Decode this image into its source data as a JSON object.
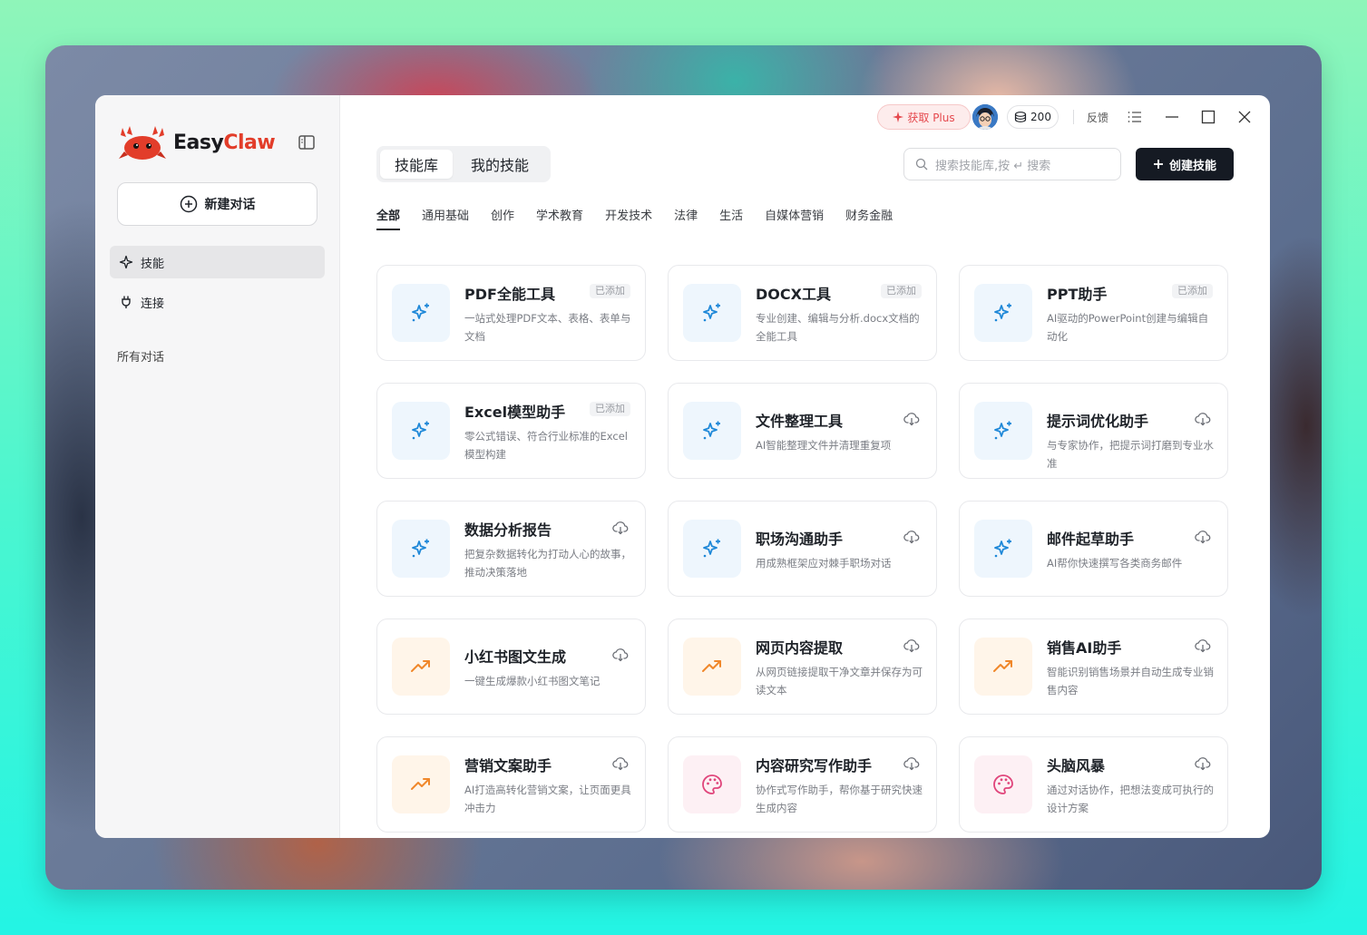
{
  "app": {
    "logo_easy": "Easy",
    "logo_claw": "Claw"
  },
  "sidebar": {
    "new_chat": "新建对话",
    "items": [
      {
        "label": "技能",
        "icon": "sparkle-icon",
        "active": true
      },
      {
        "label": "连接",
        "icon": "plug-icon",
        "active": false
      }
    ],
    "section_label": "所有对话"
  },
  "topbar": {
    "plus_label": "获取 Plus",
    "credits": "200",
    "feedback": "反馈"
  },
  "main": {
    "tabs": [
      {
        "label": "技能库",
        "active": true
      },
      {
        "label": "我的技能",
        "active": false
      }
    ],
    "search_placeholder": "搜索技能库,按 ↵ 搜索",
    "create_label": "创建技能",
    "categories": [
      "全部",
      "通用基础",
      "创作",
      "学术教育",
      "开发技术",
      "法律",
      "生活",
      "自媒体营销",
      "财务金融"
    ],
    "cards": [
      {
        "title": "PDF全能工具",
        "desc": "一站式处理PDF文本、表格、表单与文档",
        "status": "已添加",
        "icon": "sparkles-icon",
        "color": "blue"
      },
      {
        "title": "DOCX工具",
        "desc": "专业创建、编辑与分析.docx文档的全能工具",
        "status": "已添加",
        "icon": "sparkles-icon",
        "color": "blue"
      },
      {
        "title": "PPT助手",
        "desc": "AI驱动的PowerPoint创建与编辑自动化",
        "status": "已添加",
        "icon": "sparkles-icon",
        "color": "blue"
      },
      {
        "title": "Excel模型助手",
        "desc": "零公式错误、符合行业标准的Excel模型构建",
        "status": "已添加",
        "icon": "sparkles-icon",
        "color": "blue"
      },
      {
        "title": "文件整理工具",
        "desc": "AI智能整理文件并清理重复项",
        "status": "download",
        "icon": "sparkles-icon",
        "color": "blue"
      },
      {
        "title": "提示词优化助手",
        "desc": "与专家协作，把提示词打磨到专业水准",
        "status": "download",
        "icon": "sparkles-icon",
        "color": "blue"
      },
      {
        "title": "数据分析报告",
        "desc": "把复杂数据转化为打动人心的故事，推动决策落地",
        "status": "download",
        "icon": "sparkles-icon",
        "color": "blue"
      },
      {
        "title": "职场沟通助手",
        "desc": "用成熟框架应对棘手职场对话",
        "status": "download",
        "icon": "sparkles-icon",
        "color": "blue"
      },
      {
        "title": "邮件起草助手",
        "desc": "AI帮你快速撰写各类商务邮件",
        "status": "download",
        "icon": "sparkles-icon",
        "color": "blue"
      },
      {
        "title": "小红书图文生成",
        "desc": "一键生成爆款小红书图文笔记",
        "status": "download",
        "icon": "trend-icon",
        "color": "orange"
      },
      {
        "title": "网页内容提取",
        "desc": "从网页链接提取干净文章并保存为可读文本",
        "status": "download",
        "icon": "trend-icon",
        "color": "orange"
      },
      {
        "title": "销售AI助手",
        "desc": "智能识别销售场景并自动生成专业销售内容",
        "status": "download",
        "icon": "trend-icon",
        "color": "orange"
      },
      {
        "title": "营销文案助手",
        "desc": "AI打造高转化营销文案，让页面更具冲击力",
        "status": "download",
        "icon": "trend-icon",
        "color": "orange"
      },
      {
        "title": "内容研究写作助手",
        "desc": "协作式写作助手，帮你基于研究快速生成内容",
        "status": "download",
        "icon": "palette-icon",
        "color": "pink"
      },
      {
        "title": "头脑风暴",
        "desc": "通过对话协作，把想法变成可执行的设计方案",
        "status": "download",
        "icon": "palette-icon",
        "color": "pink"
      }
    ]
  },
  "colors": {
    "accent_dark": "#151a23",
    "plus_red": "#e5484d",
    "icon_blue": "#1e88d8",
    "icon_orange": "#f0872a",
    "icon_pink": "#e0457b"
  }
}
